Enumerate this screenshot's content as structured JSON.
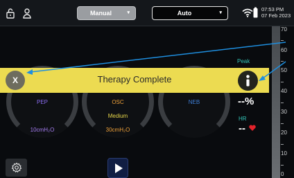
{
  "statusbar": {
    "mode_manual": "Manual",
    "mode_auto": "Auto",
    "time": "07:53 PM",
    "date": "07 Feb 2023"
  },
  "banner": {
    "text": "Therapy Complete",
    "close_label": "X"
  },
  "dials": [
    {
      "title": "PEP",
      "value": "10cmH₂O",
      "title_color": "#8a6cf0",
      "value_color": "#a67ef2"
    },
    {
      "title": "OSC",
      "sub": "Medium",
      "value": "30cmH₂O",
      "title_color": "#f0a23a",
      "value_color": "#f0a23a"
    },
    {
      "title": "NEB",
      "title_color": "#3f7fd6"
    }
  ],
  "readouts": {
    "peak_label": "Peak",
    "spo2_value": "--%",
    "hr_label": "HR",
    "hr_value": "--"
  },
  "scale": {
    "labels": [
      "70",
      "60",
      "50",
      "40",
      "30",
      "20",
      "10",
      "0"
    ]
  },
  "icons": {
    "lock": "lock-icon",
    "user": "user-icon",
    "wifi": "wifi-icon",
    "battery": "battery-icon",
    "heart": "heart-icon",
    "settings": "settings-gear-icon",
    "play": "play-icon",
    "info": "info-icon",
    "close": "close-icon"
  },
  "colors": {
    "banner": "#ecdb51",
    "pointer_line": "#1e8fe0",
    "accent_teal": "#33c6b8",
    "heart": "#e2222a"
  }
}
